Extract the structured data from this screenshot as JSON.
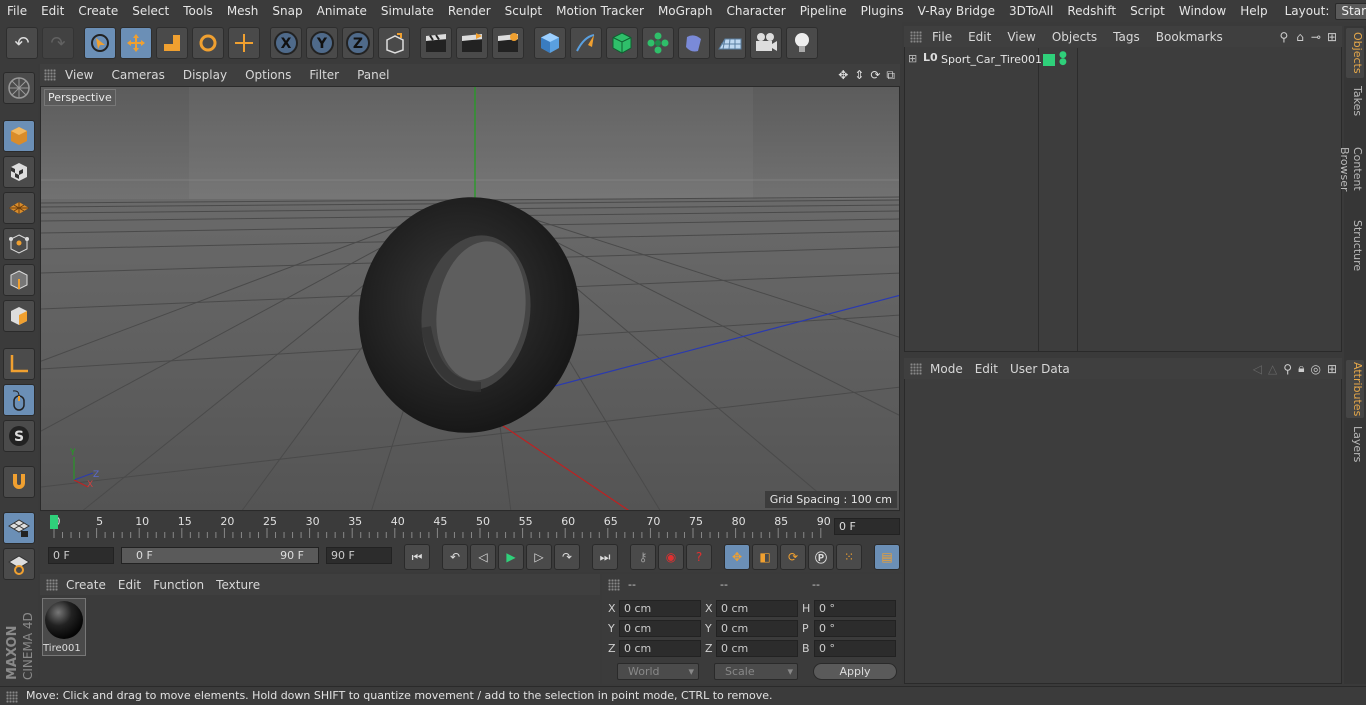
{
  "menu": [
    "File",
    "Edit",
    "Create",
    "Select",
    "Tools",
    "Mesh",
    "Snap",
    "Animate",
    "Simulate",
    "Render",
    "Sculpt",
    "Motion Tracker",
    "MoGraph",
    "Character",
    "Pipeline",
    "Plugins",
    "V-Ray Bridge",
    "3DToAll",
    "Redshift",
    "Script",
    "Window",
    "Help"
  ],
  "layout": {
    "label": "Layout:",
    "value": "Startup"
  },
  "viewport": {
    "menu": [
      "View",
      "Cameras",
      "Display",
      "Options",
      "Filter",
      "Panel"
    ],
    "label": "Perspective",
    "grid_spacing": "Grid Spacing : 100 cm"
  },
  "timeline": {
    "ticks": [
      "0",
      "5",
      "10",
      "15",
      "20",
      "25",
      "30",
      "35",
      "40",
      "45",
      "50",
      "55",
      "60",
      "65",
      "70",
      "75",
      "80",
      "85",
      "90"
    ],
    "current_frame": "0 F",
    "start_field": "0 F",
    "range_start": "0 F",
    "range_end": "90 F",
    "end_field": "90 F"
  },
  "materials": {
    "menu": [
      "Create",
      "Edit",
      "Function",
      "Texture"
    ],
    "items": [
      {
        "name": "Tire001"
      }
    ]
  },
  "coords": {
    "headers": [
      "--",
      "--",
      "--"
    ],
    "rows": [
      {
        "a": "X",
        "av": "0 cm",
        "b": "X",
        "bv": "0 cm",
        "c": "H",
        "cv": "0 °"
      },
      {
        "a": "Y",
        "av": "0 cm",
        "b": "Y",
        "bv": "0 cm",
        "c": "P",
        "cv": "0 °"
      },
      {
        "a": "Z",
        "av": "0 cm",
        "b": "Z",
        "bv": "0 cm",
        "c": "B",
        "cv": "0 °"
      }
    ],
    "mode": "World",
    "scale": "Scale",
    "apply": "Apply"
  },
  "objects": {
    "menu": [
      "File",
      "Edit",
      "View",
      "Objects",
      "Tags",
      "Bookmarks"
    ],
    "items": [
      {
        "name": "Sport_Car_Tire001"
      }
    ]
  },
  "attributes": {
    "menu": [
      "Mode",
      "Edit",
      "User Data"
    ]
  },
  "right_tabs": [
    "Objects",
    "Takes",
    "Content Browser",
    "Structure",
    "Attributes",
    "Layers"
  ],
  "brand": {
    "maxon": "MAXON",
    "product": "CINEMA 4D"
  },
  "status": "Move: Click and drag to move elements. Hold down SHIFT to quantize movement / add to the selection in point mode, CTRL to remove.",
  "colors": {
    "accent": "#6b8fb6",
    "orange": "#f0a030",
    "green": "#2fd07a"
  }
}
